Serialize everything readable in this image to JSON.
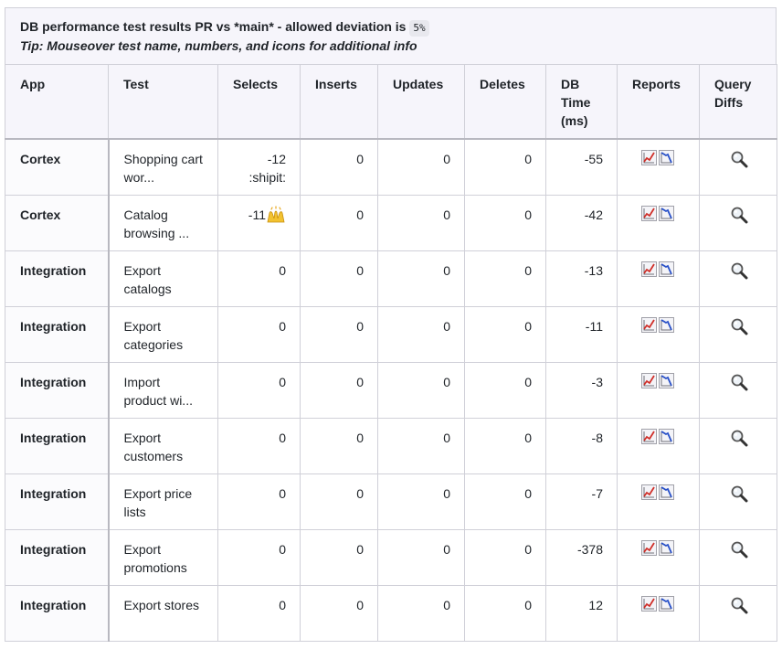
{
  "caption": {
    "title": "DB performance test results PR vs *main* - allowed deviation is",
    "deviation": "5%",
    "tip": "Tip: Mouseover test name, numbers, and icons for additional info"
  },
  "columns": [
    "App",
    "Test",
    "Selects",
    "Inserts",
    "Updates",
    "Deletes",
    "DB Time (ms)",
    "Reports",
    "Query Diffs"
  ],
  "rows": [
    {
      "app": "Cortex",
      "test": "Shopping cart wor...",
      "selects": "-12 :shipit:",
      "inserts": "0",
      "updates": "0",
      "deletes": "0",
      "db_time": "-55",
      "selects_emoji": ""
    },
    {
      "app": "Cortex",
      "test": "Catalog browsing ...",
      "selects": "-11",
      "inserts": "0",
      "updates": "0",
      "deletes": "0",
      "db_time": "-42",
      "selects_emoji": "raising-hands-icon"
    },
    {
      "app": "Integration",
      "test": "Export catalogs",
      "selects": "0",
      "inserts": "0",
      "updates": "0",
      "deletes": "0",
      "db_time": "-13",
      "selects_emoji": ""
    },
    {
      "app": "Integration",
      "test": "Export categories",
      "selects": "0",
      "inserts": "0",
      "updates": "0",
      "deletes": "0",
      "db_time": "-11",
      "selects_emoji": ""
    },
    {
      "app": "Integration",
      "test": "Import product wi...",
      "selects": "0",
      "inserts": "0",
      "updates": "0",
      "deletes": "0",
      "db_time": "-3",
      "selects_emoji": ""
    },
    {
      "app": "Integration",
      "test": "Export customers",
      "selects": "0",
      "inserts": "0",
      "updates": "0",
      "deletes": "0",
      "db_time": "-8",
      "selects_emoji": ""
    },
    {
      "app": "Integration",
      "test": "Export price lists",
      "selects": "0",
      "inserts": "0",
      "updates": "0",
      "deletes": "0",
      "db_time": "-7",
      "selects_emoji": ""
    },
    {
      "app": "Integration",
      "test": "Export promotions",
      "selects": "0",
      "inserts": "0",
      "updates": "0",
      "deletes": "0",
      "db_time": "-378",
      "selects_emoji": ""
    },
    {
      "app": "Integration",
      "test": "Export stores",
      "selects": "0",
      "inserts": "0",
      "updates": "0",
      "deletes": "0",
      "db_time": "12",
      "selects_emoji": ""
    }
  ],
  "icons": {
    "report_up": "chart-increasing-icon",
    "report_down": "chart-decreasing-icon",
    "query_diff": "magnifying-glass-icon"
  },
  "colors": {
    "header_bg": "#f6f5fb",
    "border": "#d0d0d8",
    "chart_up": "#d0302a",
    "chart_down": "#2850c8"
  }
}
